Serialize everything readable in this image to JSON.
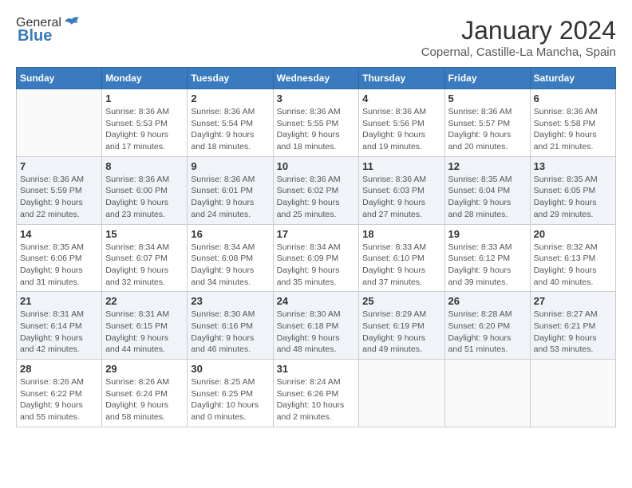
{
  "logo": {
    "general": "General",
    "blue": "Blue"
  },
  "header": {
    "month": "January 2024",
    "location": "Copernal, Castille-La Mancha, Spain"
  },
  "days_of_week": [
    "Sunday",
    "Monday",
    "Tuesday",
    "Wednesday",
    "Thursday",
    "Friday",
    "Saturday"
  ],
  "weeks": [
    [
      {
        "day": "",
        "info": ""
      },
      {
        "day": "1",
        "info": "Sunrise: 8:36 AM\nSunset: 5:53 PM\nDaylight: 9 hours\nand 17 minutes."
      },
      {
        "day": "2",
        "info": "Sunrise: 8:36 AM\nSunset: 5:54 PM\nDaylight: 9 hours\nand 18 minutes."
      },
      {
        "day": "3",
        "info": "Sunrise: 8:36 AM\nSunset: 5:55 PM\nDaylight: 9 hours\nand 18 minutes."
      },
      {
        "day": "4",
        "info": "Sunrise: 8:36 AM\nSunset: 5:56 PM\nDaylight: 9 hours\nand 19 minutes."
      },
      {
        "day": "5",
        "info": "Sunrise: 8:36 AM\nSunset: 5:57 PM\nDaylight: 9 hours\nand 20 minutes."
      },
      {
        "day": "6",
        "info": "Sunrise: 8:36 AM\nSunset: 5:58 PM\nDaylight: 9 hours\nand 21 minutes."
      }
    ],
    [
      {
        "day": "7",
        "info": "Sunrise: 8:36 AM\nSunset: 5:59 PM\nDaylight: 9 hours\nand 22 minutes."
      },
      {
        "day": "8",
        "info": "Sunrise: 8:36 AM\nSunset: 6:00 PM\nDaylight: 9 hours\nand 23 minutes."
      },
      {
        "day": "9",
        "info": "Sunrise: 8:36 AM\nSunset: 6:01 PM\nDaylight: 9 hours\nand 24 minutes."
      },
      {
        "day": "10",
        "info": "Sunrise: 8:36 AM\nSunset: 6:02 PM\nDaylight: 9 hours\nand 25 minutes."
      },
      {
        "day": "11",
        "info": "Sunrise: 8:36 AM\nSunset: 6:03 PM\nDaylight: 9 hours\nand 27 minutes."
      },
      {
        "day": "12",
        "info": "Sunrise: 8:35 AM\nSunset: 6:04 PM\nDaylight: 9 hours\nand 28 minutes."
      },
      {
        "day": "13",
        "info": "Sunrise: 8:35 AM\nSunset: 6:05 PM\nDaylight: 9 hours\nand 29 minutes."
      }
    ],
    [
      {
        "day": "14",
        "info": "Sunrise: 8:35 AM\nSunset: 6:06 PM\nDaylight: 9 hours\nand 31 minutes."
      },
      {
        "day": "15",
        "info": "Sunrise: 8:34 AM\nSunset: 6:07 PM\nDaylight: 9 hours\nand 32 minutes."
      },
      {
        "day": "16",
        "info": "Sunrise: 8:34 AM\nSunset: 6:08 PM\nDaylight: 9 hours\nand 34 minutes."
      },
      {
        "day": "17",
        "info": "Sunrise: 8:34 AM\nSunset: 6:09 PM\nDaylight: 9 hours\nand 35 minutes."
      },
      {
        "day": "18",
        "info": "Sunrise: 8:33 AM\nSunset: 6:10 PM\nDaylight: 9 hours\nand 37 minutes."
      },
      {
        "day": "19",
        "info": "Sunrise: 8:33 AM\nSunset: 6:12 PM\nDaylight: 9 hours\nand 39 minutes."
      },
      {
        "day": "20",
        "info": "Sunrise: 8:32 AM\nSunset: 6:13 PM\nDaylight: 9 hours\nand 40 minutes."
      }
    ],
    [
      {
        "day": "21",
        "info": "Sunrise: 8:31 AM\nSunset: 6:14 PM\nDaylight: 9 hours\nand 42 minutes."
      },
      {
        "day": "22",
        "info": "Sunrise: 8:31 AM\nSunset: 6:15 PM\nDaylight: 9 hours\nand 44 minutes."
      },
      {
        "day": "23",
        "info": "Sunrise: 8:30 AM\nSunset: 6:16 PM\nDaylight: 9 hours\nand 46 minutes."
      },
      {
        "day": "24",
        "info": "Sunrise: 8:30 AM\nSunset: 6:18 PM\nDaylight: 9 hours\nand 48 minutes."
      },
      {
        "day": "25",
        "info": "Sunrise: 8:29 AM\nSunset: 6:19 PM\nDaylight: 9 hours\nand 49 minutes."
      },
      {
        "day": "26",
        "info": "Sunrise: 8:28 AM\nSunset: 6:20 PM\nDaylight: 9 hours\nand 51 minutes."
      },
      {
        "day": "27",
        "info": "Sunrise: 8:27 AM\nSunset: 6:21 PM\nDaylight: 9 hours\nand 53 minutes."
      }
    ],
    [
      {
        "day": "28",
        "info": "Sunrise: 8:26 AM\nSunset: 6:22 PM\nDaylight: 9 hours\nand 55 minutes."
      },
      {
        "day": "29",
        "info": "Sunrise: 8:26 AM\nSunset: 6:24 PM\nDaylight: 9 hours\nand 58 minutes."
      },
      {
        "day": "30",
        "info": "Sunrise: 8:25 AM\nSunset: 6:25 PM\nDaylight: 10 hours\nand 0 minutes."
      },
      {
        "day": "31",
        "info": "Sunrise: 8:24 AM\nSunset: 6:26 PM\nDaylight: 10 hours\nand 2 minutes."
      },
      {
        "day": "",
        "info": ""
      },
      {
        "day": "",
        "info": ""
      },
      {
        "day": "",
        "info": ""
      }
    ]
  ]
}
